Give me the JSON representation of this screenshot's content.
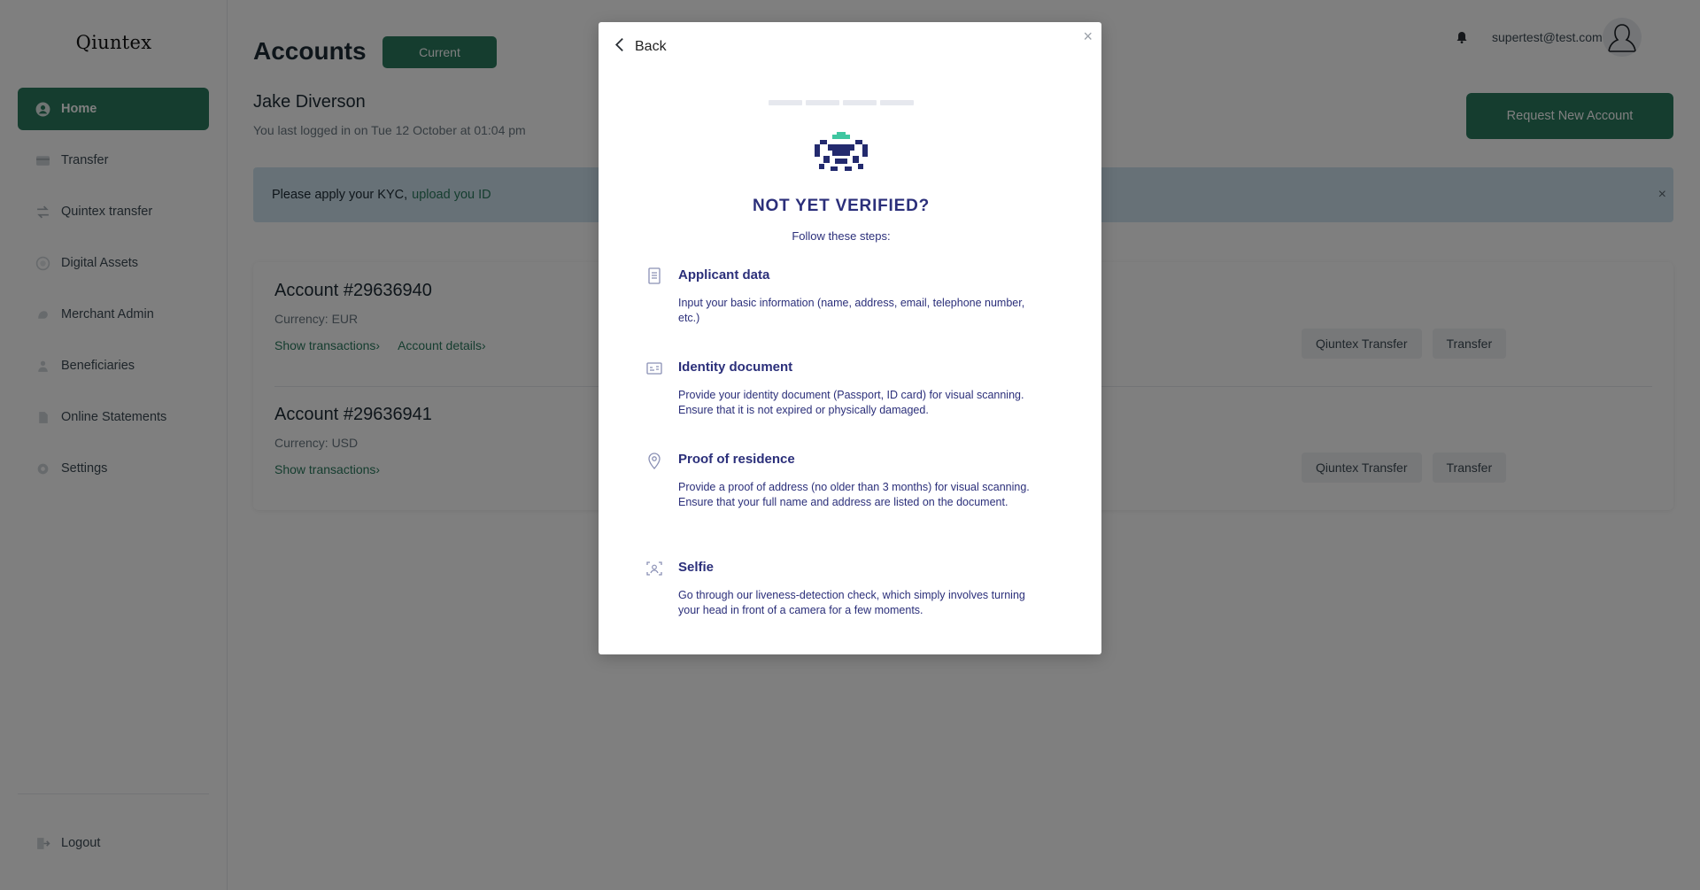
{
  "brand": {
    "logo": "Qiuntex",
    "accent": "#2a7a5e",
    "modal_text": "#2b2f7a"
  },
  "sidebar": {
    "items": [
      {
        "label": "Home",
        "icon": "user-circle-icon",
        "active": true
      },
      {
        "label": "Transfer",
        "icon": "card-icon"
      },
      {
        "label": "Quintex transfer",
        "icon": "swap-icon"
      },
      {
        "label": "Digital Assets",
        "icon": "coin-icon"
      },
      {
        "label": "Merchant Admin",
        "icon": "merchant-icon"
      },
      {
        "label": "Beneficiaries",
        "icon": "people-icon"
      },
      {
        "label": "Online Statements",
        "icon": "statement-icon"
      },
      {
        "label": "Settings",
        "icon": "gear-icon"
      }
    ],
    "logout": "Logout"
  },
  "header": {
    "title": "Accounts",
    "current_label": "Current",
    "user_name": "Jake Diverson",
    "last_login": "You last logged in on Tue 12 October at 01:04 pm",
    "email": "supertest@test.com",
    "request_button": "Request New Account"
  },
  "kyc_banner": {
    "text": "Please apply your KYC,",
    "link": "upload you ID",
    "close": "×"
  },
  "accounts": [
    {
      "title": "Account #29636940",
      "currency": "Currency: EUR",
      "links": [
        "Show transactions›",
        "Account details›"
      ],
      "buttons": [
        "Qiuntex Transfer",
        "Transfer"
      ]
    },
    {
      "title": "Account #29636941",
      "currency": "Currency: USD",
      "links": [
        "Show transactions›"
      ],
      "buttons": [
        "Qiuntex Transfer",
        "Transfer"
      ]
    }
  ],
  "modal": {
    "back": "Back",
    "close": "×",
    "title": "NOT YET VERIFIED?",
    "subtitle": "Follow these steps:",
    "steps": [
      {
        "title": "Applicant data",
        "icon": "document-icon",
        "desc": "Input your basic information (name, address, email, telephone number, etc.)"
      },
      {
        "title": "Identity document",
        "icon": "id-card-icon",
        "desc": "Provide your identity document (Passport, ID card) for visual scanning. Ensure that it is not expired or physically damaged."
      },
      {
        "title": "Proof of residence",
        "icon": "location-pin-icon",
        "desc": "Provide a proof of address (no older than 3 months) for visual scanning. Ensure that your full name and address are listed on the document."
      },
      {
        "title": "Selfie",
        "icon": "face-scan-icon",
        "desc": "Go through our liveness-detection check, which simply involves turning your head in front of a camera for a few moments."
      }
    ]
  }
}
